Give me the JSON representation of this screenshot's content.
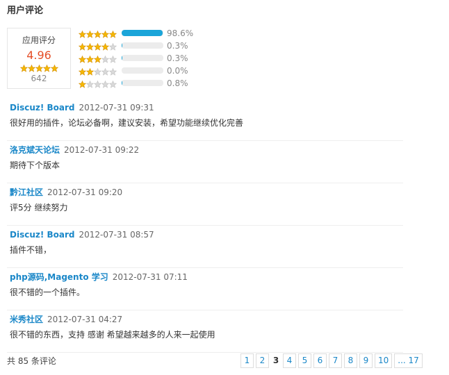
{
  "section": {
    "title": "用户评论"
  },
  "summary": {
    "label": "应用评分",
    "score": "4.96",
    "stars_filled": 5,
    "count": "642"
  },
  "distribution": [
    {
      "stars": 5,
      "pct_label": "98.6%",
      "fraction": 0.986
    },
    {
      "stars": 4,
      "pct_label": "0.3%",
      "fraction": 0.003
    },
    {
      "stars": 3,
      "pct_label": "0.3%",
      "fraction": 0.003
    },
    {
      "stars": 2,
      "pct_label": "0.0%",
      "fraction": 0.0
    },
    {
      "stars": 1,
      "pct_label": "0.8%",
      "fraction": 0.008
    }
  ],
  "comments": [
    {
      "author": "Discuz! Board",
      "time": "2012-07-31 09:31",
      "text": "很好用的插件，论坛必备啊，建议安装，希望功能继续优化完善"
    },
    {
      "author": "洛克斌天论坛",
      "time": "2012-07-31 09:22",
      "text": "期待下个版本"
    },
    {
      "author": "黔江社区",
      "time": "2012-07-31 09:20",
      "text": "评5分 继续努力"
    },
    {
      "author": "Discuz! Board",
      "time": "2012-07-31 08:57",
      "text": "插件不错，"
    },
    {
      "author": "php源码,Magento 学习",
      "time": "2012-07-31 07:11",
      "text": "很不错的一个插件。"
    },
    {
      "author": "米秀社区",
      "time": "2012-07-31 04:27",
      "text": "很不错的东西，支持 感谢 希望越来越多的人来一起使用"
    }
  ],
  "footer": {
    "total_text": "共 85 条评论"
  },
  "pagination": {
    "current": "3",
    "pages": [
      "1",
      "2",
      "3",
      "4",
      "5",
      "6",
      "7",
      "8",
      "9",
      "10",
      "... 17"
    ]
  },
  "colors": {
    "star_fill": "#f5b800",
    "star_empty": "#d9d9d9",
    "bar_fill": "#1ba5d9",
    "link": "#1a87c8",
    "score": "#e44d26"
  }
}
